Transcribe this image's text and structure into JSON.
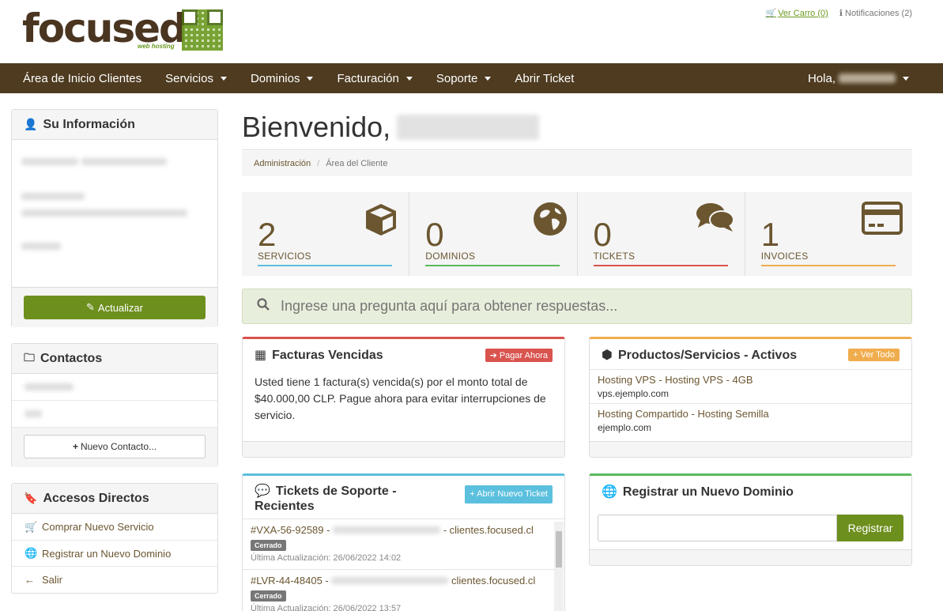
{
  "header": {
    "logo_text": "focused",
    "logo_sub": "web hosting",
    "cart_label": "Ver Carro (0)",
    "notifications_label": "Notificaciones (2)"
  },
  "nav": {
    "items": [
      {
        "label": "Área de Inicio Clientes"
      },
      {
        "label": "Servicios"
      },
      {
        "label": "Dominios"
      },
      {
        "label": "Facturación"
      },
      {
        "label": "Soporte"
      },
      {
        "label": "Abrir Ticket"
      }
    ],
    "greeting": "Hola,"
  },
  "sidebar": {
    "info_title": "Su Información",
    "update_button": "Actualizar",
    "contacts_title": "Contactos",
    "new_contact_button": "Nuevo Contacto...",
    "shortcuts_title": "Accesos Directos",
    "shortcuts": [
      {
        "label": "Comprar Nuevo Servicio"
      },
      {
        "label": "Registrar un Nuevo Dominio"
      },
      {
        "label": "Salir"
      }
    ]
  },
  "main": {
    "welcome": "Bienvenido,",
    "breadcrumb": [
      "Administración",
      "Área del Cliente"
    ],
    "stats": [
      {
        "value": "2",
        "label": "SERVICIOS",
        "color": "#5bc0de"
      },
      {
        "value": "0",
        "label": "DOMINIOS",
        "color": "#5cb85c"
      },
      {
        "value": "0",
        "label": "TICKETS",
        "color": "#d9534f"
      },
      {
        "value": "1",
        "label": "INVOICES",
        "color": "#f0ad4e"
      }
    ],
    "search_placeholder": "Ingrese una pregunta aquí para obtener respuestas..."
  },
  "invoices_card": {
    "title": "Facturas Vencidas",
    "button": "Pagar Ahora",
    "text": "Usted tiene 1 factura(s) vencida(s) por el monto total de $40.000,00 CLP. Pague ahora para evitar interrupciones de servicio.",
    "accent": "#d9534f"
  },
  "products_card": {
    "title": "Productos/Servicios - Activos",
    "button": "Ver Todo",
    "accent": "#f0ad4e",
    "items": [
      {
        "title": "Hosting VPS - Hosting VPS - 4GB",
        "domain": "vps.ejemplo.com"
      },
      {
        "title": "Hosting Compartido - Hosting Semilla",
        "domain": "ejemplo.com"
      }
    ]
  },
  "tickets_card": {
    "title": "Tickets de Soporte - Recientes",
    "button": "Abrir Nuevo Ticket",
    "accent": "#5bc0de",
    "tickets": [
      {
        "id": "#VXA-56-92589 -",
        "dept": "- clientes.focused.cl",
        "status": "Cerrado",
        "updated": "Última Actualización: 26/06/2022 14:02"
      },
      {
        "id": "#LVR-44-48405 -",
        "dept": "clientes.focused.cl",
        "status": "Cerrado",
        "updated": "Última Actualización: 26/06/2022 13:57"
      }
    ]
  },
  "domain_card": {
    "title": "Registrar un Nuevo Dominio",
    "button": "Registrar",
    "accent": "#5cb85c"
  }
}
